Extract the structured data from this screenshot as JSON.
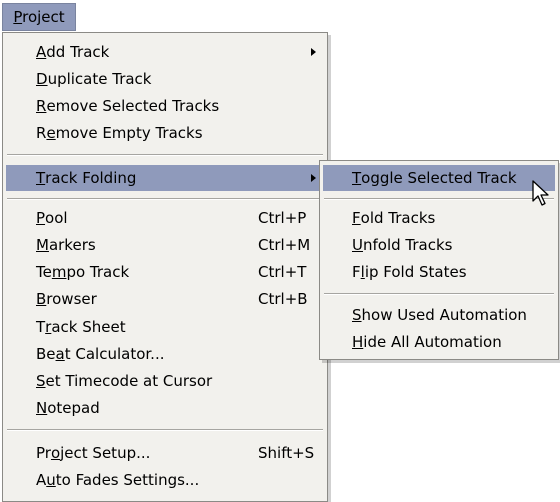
{
  "menubar": {
    "project_pre": "",
    "project_key": "P",
    "project_post": "roject"
  },
  "main_menu": {
    "add_track": {
      "pre": "",
      "key": "A",
      "post": "dd Track"
    },
    "duplicate_track": {
      "pre": "",
      "key": "D",
      "post": "uplicate Track"
    },
    "remove_selected": {
      "pre": "",
      "key": "R",
      "post": "emove Selected Tracks"
    },
    "remove_empty": {
      "pre": "R",
      "key": "e",
      "post": "move Empty Tracks"
    },
    "track_folding": {
      "pre": "",
      "key": "T",
      "post": "rack Folding"
    },
    "pool": {
      "pre": "",
      "key": "P",
      "post": "ool",
      "shortcut": "Ctrl+P"
    },
    "markers": {
      "pre": "",
      "key": "M",
      "post": "arkers",
      "shortcut": "Ctrl+M"
    },
    "tempo_track": {
      "pre": "Te",
      "key": "m",
      "post": "po Track",
      "shortcut": "Ctrl+T"
    },
    "browser": {
      "pre": "",
      "key": "B",
      "post": "rowser",
      "shortcut": "Ctrl+B"
    },
    "track_sheet": {
      "pre": "T",
      "key": "r",
      "post": "ack Sheet"
    },
    "beat_calculator": {
      "pre": "Be",
      "key": "a",
      "post": "t Calculator..."
    },
    "set_timecode": {
      "pre": "",
      "key": "S",
      "post": "et Timecode at Cursor"
    },
    "notepad": {
      "pre": "",
      "key": "N",
      "post": "otepad"
    },
    "project_setup": {
      "pre": "Pr",
      "key": "o",
      "post": "ject Setup...",
      "shortcut": "Shift+S"
    },
    "auto_fades": {
      "pre": "A",
      "key": "u",
      "post": "to Fades Settings..."
    }
  },
  "sub_menu": {
    "toggle_selected": {
      "pre": "",
      "key": "T",
      "post": "oggle Selected Track"
    },
    "fold_tracks": {
      "pre": "",
      "key": "F",
      "post": "old Tracks"
    },
    "unfold_tracks": {
      "pre": "",
      "key": "U",
      "post": "nfold Tracks"
    },
    "flip_fold": {
      "pre": "F",
      "key": "l",
      "post": "ip Fold States"
    },
    "show_used_auto": {
      "pre": "",
      "key": "S",
      "post": "how Used Automation"
    },
    "hide_all_auto": {
      "pre": "",
      "key": "H",
      "post": "ide All Automation"
    }
  },
  "colors": {
    "highlight": "#8f9abb",
    "menu_bg": "#f2f1ed",
    "border": "#8b8a86"
  },
  "icons": {
    "submenu_arrow": "arrow-right-icon",
    "cursor": "mouse-pointer-icon"
  }
}
